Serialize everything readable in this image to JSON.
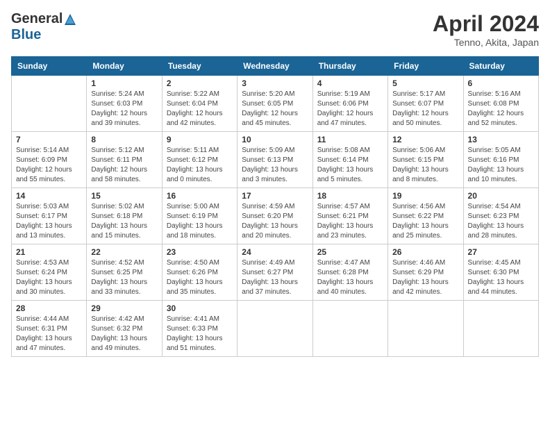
{
  "header": {
    "logo_general": "General",
    "logo_blue": "Blue",
    "month": "April 2024",
    "location": "Tenno, Akita, Japan"
  },
  "weekdays": [
    "Sunday",
    "Monday",
    "Tuesday",
    "Wednesday",
    "Thursday",
    "Friday",
    "Saturday"
  ],
  "weeks": [
    [
      {
        "day": "",
        "info": ""
      },
      {
        "day": "1",
        "info": "Sunrise: 5:24 AM\nSunset: 6:03 PM\nDaylight: 12 hours\nand 39 minutes."
      },
      {
        "day": "2",
        "info": "Sunrise: 5:22 AM\nSunset: 6:04 PM\nDaylight: 12 hours\nand 42 minutes."
      },
      {
        "day": "3",
        "info": "Sunrise: 5:20 AM\nSunset: 6:05 PM\nDaylight: 12 hours\nand 45 minutes."
      },
      {
        "day": "4",
        "info": "Sunrise: 5:19 AM\nSunset: 6:06 PM\nDaylight: 12 hours\nand 47 minutes."
      },
      {
        "day": "5",
        "info": "Sunrise: 5:17 AM\nSunset: 6:07 PM\nDaylight: 12 hours\nand 50 minutes."
      },
      {
        "day": "6",
        "info": "Sunrise: 5:16 AM\nSunset: 6:08 PM\nDaylight: 12 hours\nand 52 minutes."
      }
    ],
    [
      {
        "day": "7",
        "info": "Sunrise: 5:14 AM\nSunset: 6:09 PM\nDaylight: 12 hours\nand 55 minutes."
      },
      {
        "day": "8",
        "info": "Sunrise: 5:12 AM\nSunset: 6:11 PM\nDaylight: 12 hours\nand 58 minutes."
      },
      {
        "day": "9",
        "info": "Sunrise: 5:11 AM\nSunset: 6:12 PM\nDaylight: 13 hours\nand 0 minutes."
      },
      {
        "day": "10",
        "info": "Sunrise: 5:09 AM\nSunset: 6:13 PM\nDaylight: 13 hours\nand 3 minutes."
      },
      {
        "day": "11",
        "info": "Sunrise: 5:08 AM\nSunset: 6:14 PM\nDaylight: 13 hours\nand 5 minutes."
      },
      {
        "day": "12",
        "info": "Sunrise: 5:06 AM\nSunset: 6:15 PM\nDaylight: 13 hours\nand 8 minutes."
      },
      {
        "day": "13",
        "info": "Sunrise: 5:05 AM\nSunset: 6:16 PM\nDaylight: 13 hours\nand 10 minutes."
      }
    ],
    [
      {
        "day": "14",
        "info": "Sunrise: 5:03 AM\nSunset: 6:17 PM\nDaylight: 13 hours\nand 13 minutes."
      },
      {
        "day": "15",
        "info": "Sunrise: 5:02 AM\nSunset: 6:18 PM\nDaylight: 13 hours\nand 15 minutes."
      },
      {
        "day": "16",
        "info": "Sunrise: 5:00 AM\nSunset: 6:19 PM\nDaylight: 13 hours\nand 18 minutes."
      },
      {
        "day": "17",
        "info": "Sunrise: 4:59 AM\nSunset: 6:20 PM\nDaylight: 13 hours\nand 20 minutes."
      },
      {
        "day": "18",
        "info": "Sunrise: 4:57 AM\nSunset: 6:21 PM\nDaylight: 13 hours\nand 23 minutes."
      },
      {
        "day": "19",
        "info": "Sunrise: 4:56 AM\nSunset: 6:22 PM\nDaylight: 13 hours\nand 25 minutes."
      },
      {
        "day": "20",
        "info": "Sunrise: 4:54 AM\nSunset: 6:23 PM\nDaylight: 13 hours\nand 28 minutes."
      }
    ],
    [
      {
        "day": "21",
        "info": "Sunrise: 4:53 AM\nSunset: 6:24 PM\nDaylight: 13 hours\nand 30 minutes."
      },
      {
        "day": "22",
        "info": "Sunrise: 4:52 AM\nSunset: 6:25 PM\nDaylight: 13 hours\nand 33 minutes."
      },
      {
        "day": "23",
        "info": "Sunrise: 4:50 AM\nSunset: 6:26 PM\nDaylight: 13 hours\nand 35 minutes."
      },
      {
        "day": "24",
        "info": "Sunrise: 4:49 AM\nSunset: 6:27 PM\nDaylight: 13 hours\nand 37 minutes."
      },
      {
        "day": "25",
        "info": "Sunrise: 4:47 AM\nSunset: 6:28 PM\nDaylight: 13 hours\nand 40 minutes."
      },
      {
        "day": "26",
        "info": "Sunrise: 4:46 AM\nSunset: 6:29 PM\nDaylight: 13 hours\nand 42 minutes."
      },
      {
        "day": "27",
        "info": "Sunrise: 4:45 AM\nSunset: 6:30 PM\nDaylight: 13 hours\nand 44 minutes."
      }
    ],
    [
      {
        "day": "28",
        "info": "Sunrise: 4:44 AM\nSunset: 6:31 PM\nDaylight: 13 hours\nand 47 minutes."
      },
      {
        "day": "29",
        "info": "Sunrise: 4:42 AM\nSunset: 6:32 PM\nDaylight: 13 hours\nand 49 minutes."
      },
      {
        "day": "30",
        "info": "Sunrise: 4:41 AM\nSunset: 6:33 PM\nDaylight: 13 hours\nand 51 minutes."
      },
      {
        "day": "",
        "info": ""
      },
      {
        "day": "",
        "info": ""
      },
      {
        "day": "",
        "info": ""
      },
      {
        "day": "",
        "info": ""
      }
    ]
  ]
}
